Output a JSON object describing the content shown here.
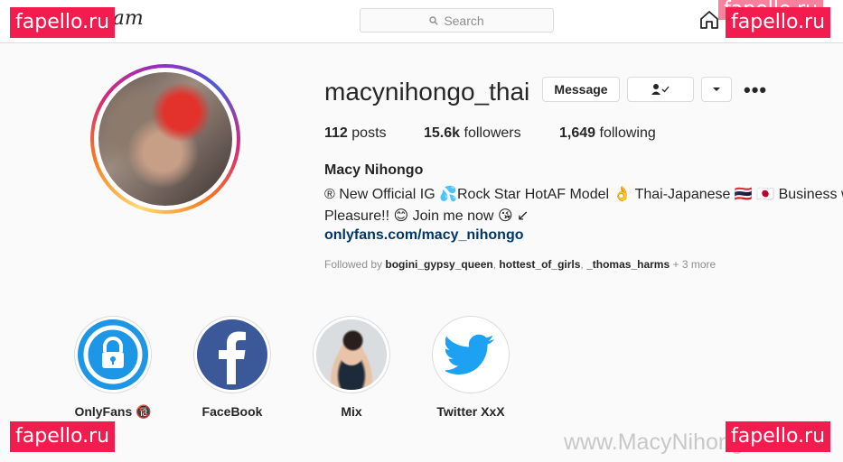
{
  "topbar": {
    "brand": "Instagram",
    "search_placeholder": "Search"
  },
  "watermark": {
    "badge": "fapello.ru",
    "url": "www.MacyNihongo.com"
  },
  "profile": {
    "username": "macynihongo_thai",
    "message_button": "Message",
    "more_label": "•••",
    "posts_count": "112",
    "posts_label": "posts",
    "followers_count": "15.6k",
    "followers_label": "followers",
    "following_count": "1,649",
    "following_label": "following",
    "full_name": "Macy Nihongo",
    "bio_line1": "® New Official IG 💦Rock Star HotAF Model 👌 Thai-Japanese 🇹🇭 🇯🇵 Business w",
    "bio_line2": "Pleasure!! 😊 Join me now 😘 ↙",
    "link": "onlyfans.com/macy_nihongo",
    "followed_by_prefix": "Followed by",
    "followed_by_users": [
      "bogini_gypsy_queen",
      "hottest_of_girls",
      "_thomas_harms"
    ],
    "followed_by_more": "+ 3 more"
  },
  "highlights": [
    {
      "label": "OnlyFans 🔞",
      "icon": "padlock-icon",
      "color": "#1da1f2"
    },
    {
      "label": "FaceBook",
      "icon": "facebook-icon",
      "color": "#3b5998"
    },
    {
      "label": "Mix",
      "icon": "photo-thumbnail"
    },
    {
      "label": "Twitter XxX",
      "icon": "twitter-bird-icon",
      "color": "#1da1f2"
    }
  ]
}
